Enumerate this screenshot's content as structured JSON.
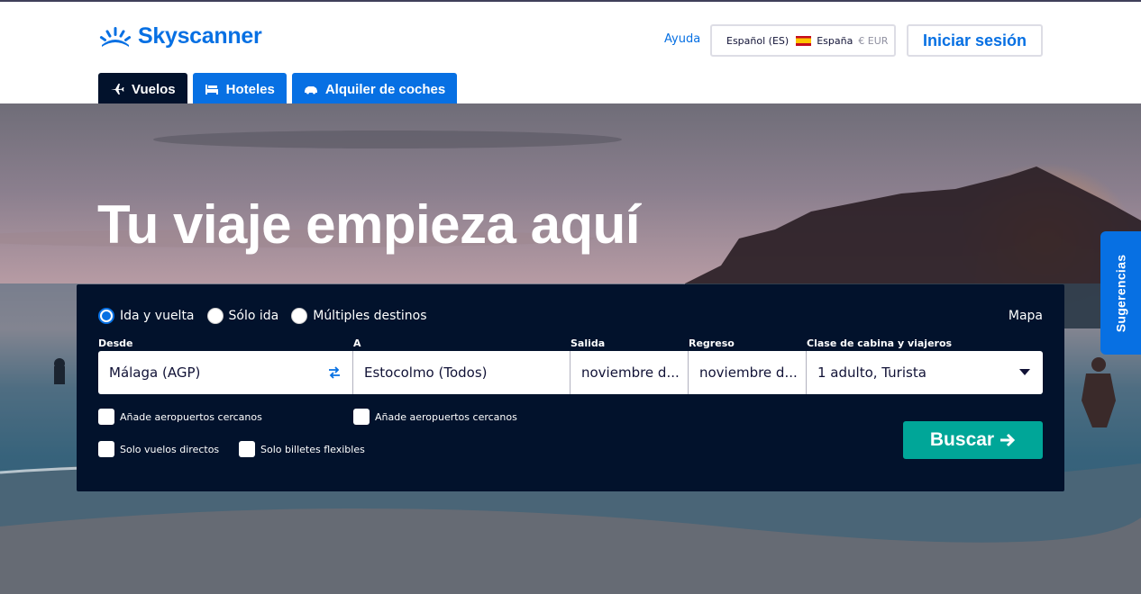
{
  "brand": {
    "name": "Skyscanner",
    "color": "#0770e3",
    "logo_icon": "sunrise-logo-icon"
  },
  "header": {
    "help_label": "Ayuda",
    "locale": {
      "language": "Español (ES)",
      "country": "España",
      "currency": "€ EUR"
    },
    "login_label": "Iniciar sesión"
  },
  "tabs": [
    {
      "label": "Vuelos",
      "icon": "plane-icon",
      "active": true
    },
    {
      "label": "Hoteles",
      "icon": "bed-icon",
      "active": false
    },
    {
      "label": "Alquiler de coches",
      "icon": "car-icon",
      "active": false
    }
  ],
  "hero": {
    "title": "Tu viaje empieza aquí"
  },
  "search": {
    "trip_types": [
      {
        "label": "Ida y vuelta",
        "checked": true
      },
      {
        "label": "Sólo ida",
        "checked": false
      },
      {
        "label": "Múltiples destinos",
        "checked": false
      }
    ],
    "map_label": "Mapa",
    "labels": {
      "from": "Desde",
      "to": "A",
      "depart": "Salida",
      "return": "Regreso",
      "cabin": "Clase de cabina y viajeros"
    },
    "values": {
      "from": "Málaga (AGP)",
      "to": "Estocolmo (Todos)",
      "depart": "noviembre d...",
      "return": "noviembre d...",
      "cabin": "1 adulto, Turista"
    },
    "checkboxes": {
      "nearby_from": "Añade aeropuertos cercanos",
      "nearby_to": "Añade aeropuertos cercanos",
      "direct": "Solo vuelos directos",
      "flexible": "Solo billetes flexibles"
    },
    "search_label": "Buscar",
    "search_color": "#00a698"
  },
  "side_tab": {
    "label": "Sugerencias"
  }
}
